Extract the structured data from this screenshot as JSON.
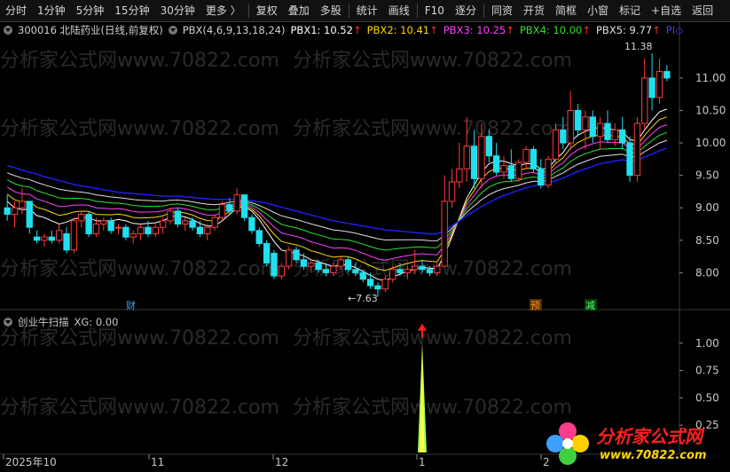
{
  "toolbar": {
    "items": [
      "分时",
      "1分钟",
      "5分钟",
      "15分钟",
      "30分钟",
      "更多 〉",
      "复权",
      "叠加",
      "多股",
      "统计",
      "画线",
      "F10",
      "逐分",
      "同资",
      "开货",
      "简框",
      "小窗",
      "标记",
      "+自选",
      "返回"
    ]
  },
  "main_legend": {
    "stock": "300016 北陆药业(日线,前复权)",
    "indicator": "PBX(4,6,9,13,18,24)",
    "pbx1": "PBX1: 10.52",
    "pbx2": "PBX2: 10.41",
    "pbx3": "PBX3: 10.25",
    "pbx4": "PBX4: 10.00",
    "pbx5": "PBX5: 9.77",
    "pbx6": "PI◇",
    "arrow": "↑"
  },
  "sub_legend": {
    "name": "创业牛扫描",
    "xg": "XG: 0.00"
  },
  "watermark": "分析家公式网www.70822.com",
  "markers": {
    "cai": "财",
    "yu": "预",
    "jian": "减"
  },
  "annotations": {
    "high": "11.38",
    "low": "←7.63"
  },
  "logo": {
    "main": "分析家公式网",
    "url": "www.70822.com"
  },
  "colors": {
    "up": "#ff3b3b",
    "down": "#20e0ef",
    "pbx1": "#ffffff",
    "pbx2": "#ffd700",
    "pbx3": "#ff40ff",
    "pbx4": "#30e030",
    "pbx5": "#e0e0e0",
    "pbx6": "#2020ff",
    "signal_fill": "#ffff40",
    "signal_side": "#a0ff60"
  },
  "chart_data": [
    {
      "type": "candlestick",
      "title": "300016 北陆药业(日线,前复权)",
      "x_ticks": [
        "2025年10",
        "11",
        "12",
        "1",
        "2"
      ],
      "ylim": [
        7.5,
        11.6
      ],
      "y_ticks": [
        8.0,
        8.5,
        9.0,
        9.5,
        10.0,
        10.5,
        11.0
      ],
      "ohlc": [
        [
          9.0,
          9.2,
          8.8,
          8.9
        ],
        [
          8.9,
          9.1,
          8.7,
          9.0
        ],
        [
          9.0,
          9.3,
          8.9,
          9.1
        ],
        [
          9.1,
          9.1,
          8.6,
          8.7
        ],
        [
          8.55,
          8.65,
          8.45,
          8.5
        ],
        [
          8.5,
          8.6,
          8.4,
          8.55
        ],
        [
          8.55,
          8.65,
          8.45,
          8.5
        ],
        [
          8.5,
          8.75,
          8.45,
          8.65
        ],
        [
          8.6,
          8.7,
          8.3,
          8.35
        ],
        [
          8.35,
          8.85,
          8.3,
          8.8
        ],
        [
          8.8,
          8.95,
          8.7,
          8.9
        ],
        [
          8.9,
          8.95,
          8.55,
          8.6
        ],
        [
          8.6,
          8.85,
          8.55,
          8.75
        ],
        [
          8.75,
          8.85,
          8.65,
          8.8
        ],
        [
          8.8,
          8.85,
          8.6,
          8.65
        ],
        [
          8.7,
          8.75,
          8.6,
          8.7
        ],
        [
          8.7,
          8.75,
          8.5,
          8.55
        ],
        [
          8.55,
          8.65,
          8.45,
          8.6
        ],
        [
          8.6,
          8.75,
          8.5,
          8.7
        ],
        [
          8.7,
          8.8,
          8.55,
          8.6
        ],
        [
          8.6,
          8.75,
          8.55,
          8.7
        ],
        [
          8.7,
          8.85,
          8.6,
          8.8
        ],
        [
          8.8,
          9.0,
          8.75,
          8.95
        ],
        [
          8.95,
          9.0,
          8.7,
          8.75
        ],
        [
          8.75,
          8.85,
          8.65,
          8.8
        ],
        [
          8.8,
          8.85,
          8.65,
          8.7
        ],
        [
          8.7,
          8.8,
          8.55,
          8.6
        ],
        [
          8.6,
          8.75,
          8.5,
          8.7
        ],
        [
          8.7,
          8.9,
          8.65,
          8.85
        ],
        [
          8.85,
          9.1,
          8.8,
          9.05
        ],
        [
          9.05,
          9.15,
          8.9,
          8.95
        ],
        [
          8.95,
          9.3,
          8.9,
          9.2
        ],
        [
          9.2,
          9.2,
          8.8,
          8.85
        ],
        [
          8.85,
          8.9,
          8.6,
          8.65
        ],
        [
          8.65,
          8.7,
          8.4,
          8.45
        ],
        [
          8.45,
          8.5,
          8.1,
          8.15
        ],
        [
          8.3,
          8.35,
          7.9,
          7.95
        ],
        [
          7.95,
          8.15,
          7.9,
          8.1
        ],
        [
          8.1,
          8.4,
          8.05,
          8.35
        ],
        [
          8.35,
          8.4,
          8.15,
          8.2
        ],
        [
          8.2,
          8.3,
          8.05,
          8.1
        ],
        [
          8.1,
          8.2,
          8.0,
          8.15
        ],
        [
          8.15,
          8.2,
          8.0,
          8.05
        ],
        [
          8.05,
          8.15,
          7.95,
          8.0
        ],
        [
          8.0,
          8.15,
          7.95,
          8.1
        ],
        [
          8.1,
          8.25,
          8.05,
          8.2
        ],
        [
          8.2,
          8.25,
          8.0,
          8.05
        ],
        [
          8.05,
          8.15,
          7.95,
          8.0
        ],
        [
          8.0,
          8.05,
          7.85,
          7.9
        ],
        [
          7.9,
          8.0,
          7.75,
          7.8
        ],
        [
          7.8,
          7.85,
          7.63,
          7.75
        ],
        [
          7.75,
          7.95,
          7.7,
          7.9
        ],
        [
          7.9,
          8.1,
          7.85,
          8.05
        ],
        [
          8.05,
          8.15,
          7.95,
          8.0
        ],
        [
          8.0,
          8.1,
          7.9,
          8.05
        ],
        [
          8.05,
          8.35,
          8.0,
          8.1
        ],
        [
          8.1,
          8.2,
          8.0,
          8.05
        ],
        [
          8.05,
          8.1,
          7.95,
          8.0
        ],
        [
          8.0,
          8.15,
          7.95,
          8.1
        ],
        [
          8.1,
          9.5,
          8.1,
          9.1
        ],
        [
          9.1,
          9.6,
          9.0,
          9.4
        ],
        [
          9.4,
          10.0,
          9.3,
          9.6
        ],
        [
          9.6,
          10.4,
          9.4,
          9.95
        ],
        [
          9.95,
          10.2,
          9.3,
          9.45
        ],
        [
          9.45,
          10.3,
          9.3,
          10.1
        ],
        [
          10.1,
          10.2,
          9.7,
          9.8
        ],
        [
          9.8,
          10.0,
          9.5,
          9.55
        ],
        [
          9.55,
          9.8,
          9.45,
          9.65
        ],
        [
          9.65,
          9.9,
          9.4,
          9.45
        ],
        [
          9.45,
          9.75,
          9.4,
          9.7
        ],
        [
          9.7,
          9.95,
          9.6,
          9.9
        ],
        [
          9.9,
          9.95,
          9.55,
          9.6
        ],
        [
          9.6,
          9.75,
          9.3,
          9.35
        ],
        [
          9.35,
          9.8,
          9.3,
          9.75
        ],
        [
          9.75,
          10.3,
          9.7,
          10.2
        ],
        [
          10.2,
          10.4,
          9.9,
          10.0
        ],
        [
          10.0,
          10.8,
          9.9,
          10.5
        ],
        [
          10.5,
          10.6,
          10.1,
          10.2
        ],
        [
          10.2,
          10.5,
          9.9,
          10.4
        ],
        [
          10.4,
          10.5,
          10.0,
          10.1
        ],
        [
          10.1,
          10.4,
          9.9,
          10.3
        ],
        [
          10.3,
          10.5,
          10.0,
          10.05
        ],
        [
          10.05,
          10.3,
          9.95,
          10.2
        ],
        [
          10.2,
          10.4,
          9.9,
          10.0
        ],
        [
          10.0,
          10.1,
          9.4,
          9.5
        ],
        [
          9.5,
          10.4,
          9.4,
          10.3
        ],
        [
          10.3,
          11.3,
          10.2,
          11.0
        ],
        [
          11.0,
          11.38,
          10.5,
          10.7
        ],
        [
          10.7,
          11.3,
          10.6,
          11.1
        ],
        [
          11.1,
          11.2,
          10.95,
          11.0
        ]
      ],
      "ma": {
        "pbx1": [
          9.1,
          9.0,
          8.97,
          8.98,
          8.88,
          8.85,
          8.8,
          8.75,
          8.78,
          8.83,
          8.85,
          8.85,
          8.8,
          8.8,
          8.8,
          8.82,
          8.8,
          8.76,
          8.75,
          8.76,
          8.77,
          8.8,
          8.86,
          8.88,
          8.86,
          8.82,
          8.76,
          8.72,
          8.72,
          8.8,
          8.9,
          9.0,
          9.02,
          8.95,
          8.82,
          8.65,
          8.48,
          8.35,
          8.32,
          8.3,
          8.26,
          8.2,
          8.17,
          8.13,
          8.1,
          8.12,
          8.12,
          8.08,
          8.02,
          7.96,
          7.9,
          7.88,
          7.93,
          7.98,
          8.02,
          8.06,
          8.08,
          8.07,
          8.06,
          8.28,
          8.55,
          8.85,
          9.15,
          9.35,
          9.55,
          9.68,
          9.72,
          9.72,
          9.68,
          9.65,
          9.68,
          9.68,
          9.6,
          9.6,
          9.75,
          9.85,
          10.02,
          10.12,
          10.18,
          10.22,
          10.24,
          10.22,
          10.2,
          10.18,
          10.05,
          10.03,
          10.2,
          10.35,
          10.48,
          10.52
        ],
        "pbx6": [
          9.65,
          9.62,
          9.58,
          9.55,
          9.52,
          9.48,
          9.45,
          9.42,
          9.39,
          9.36,
          9.34,
          9.32,
          9.3,
          9.28,
          9.26,
          9.24,
          9.23,
          9.22,
          9.21,
          9.2,
          9.19,
          9.18,
          9.18,
          9.18,
          9.17,
          9.16,
          9.15,
          9.14,
          9.13,
          9.13,
          9.13,
          9.13,
          9.12,
          9.11,
          9.09,
          9.07,
          9.04,
          9.01,
          8.98,
          8.95,
          8.92,
          8.89,
          8.86,
          8.83,
          8.8,
          8.78,
          8.76,
          8.74,
          8.72,
          8.7,
          8.68,
          8.66,
          8.65,
          8.64,
          8.63,
          8.62,
          8.61,
          8.6,
          8.6,
          8.65,
          8.72,
          8.8,
          8.88,
          8.95,
          9.02,
          9.08,
          9.14,
          9.19,
          9.23,
          9.27,
          9.31,
          9.34,
          9.36,
          9.38,
          9.42,
          9.46,
          9.51,
          9.56,
          9.6,
          9.64,
          9.68,
          9.7,
          9.72,
          9.74,
          9.72,
          9.73,
          9.78,
          9.83,
          9.88,
          9.92
        ]
      }
    },
    {
      "type": "line",
      "title": "创业牛扫描",
      "ylim": [
        0,
        1.12
      ],
      "y_ticks": [
        0.25,
        0.5,
        0.75,
        1.0
      ],
      "series": [
        {
          "name": "XG",
          "signal_index": 59,
          "value": 1.0
        }
      ]
    }
  ]
}
